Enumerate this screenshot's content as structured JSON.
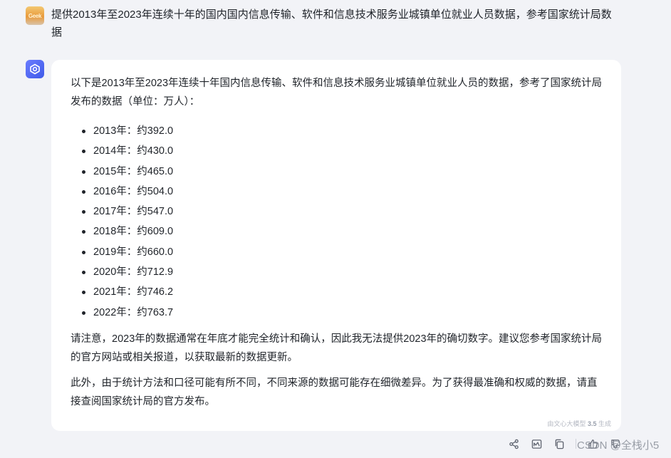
{
  "user_message": {
    "avatar_text": "Geek",
    "text": "提供2013年至2023年连续十年的国内国内信息传输、软件和信息技术服务业城镇单位就业人员数据，参考国家统计局数据"
  },
  "bot_message": {
    "intro": "以下是2013年至2023年连续十年国内信息传输、软件和信息技术服务业城镇单位就业人员的数据，参考了国家统计局发布的数据（单位：万人）：",
    "items": [
      "2013年：约392.0",
      "2014年：约430.0",
      "2015年：约465.0",
      "2016年：约504.0",
      "2017年：约547.0",
      "2018年：约609.0",
      "2019年：约660.0",
      "2020年：约712.9",
      "2021年：约746.2",
      "2022年：约763.7"
    ],
    "paragraph1": "请注意，2023年的数据通常在年底才能完全统计和确认，因此我无法提供2023年的确切数字。建议您参考国家统计局的官方网站或相关报道，以获取最新的数据更新。",
    "paragraph2": "此外，由于统计方法和口径可能有所不同，不同来源的数据可能存在细微差异。为了获得最准确和权威的数据，请直接查阅国家统计局的官方发布。",
    "generated_by_prefix": "由文心大模型",
    "generated_by_version": "3.5",
    "generated_by_suffix": "生成"
  },
  "actions": {
    "icons": [
      "share-icon",
      "chart-icon",
      "copy-icon",
      "thumbs-up-icon",
      "thumbs-down-icon"
    ]
  },
  "watermark": "CSDN @全栈小5"
}
